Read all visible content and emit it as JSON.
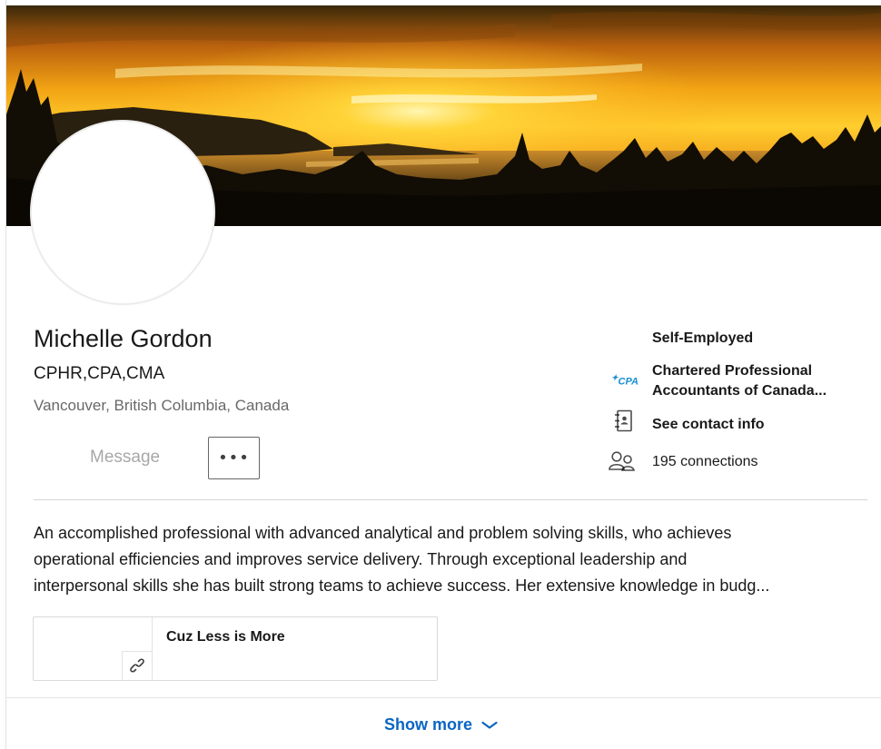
{
  "profile": {
    "name": "Michelle Gordon",
    "headline": "CPHR,CPA,CMA",
    "location": "Vancouver, British Columbia, Canada"
  },
  "actions": {
    "message_label": "Message",
    "more_label": "•••"
  },
  "sidebar": {
    "current_company": "Self-Employed",
    "education": "Chartered Professional Accountants of Canada...",
    "education_logo_text": "CPA",
    "contact_info": "See contact info",
    "connections": "195 connections"
  },
  "summary": {
    "lines": [
      "An accomplished professional with advanced analytical and problem solving skills, who achieves",
      "operational efficiencies and improves service delivery. Through exceptional leadership and",
      "interpersonal skills she has built strong teams to achieve success. Her extensive knowledge in budg..."
    ]
  },
  "media": {
    "title": "Cuz Less is More",
    "icon": "link-icon"
  },
  "footer": {
    "show_more_label": "Show more"
  },
  "colors": {
    "link_blue": "#0a66c2",
    "cpa_blue": "#1a8fd0",
    "sunset_orange": "#f2a414"
  }
}
